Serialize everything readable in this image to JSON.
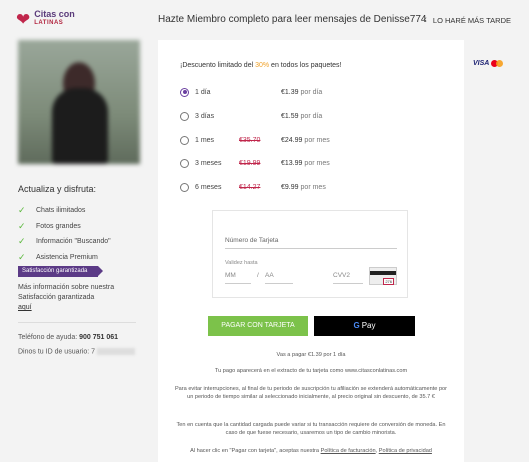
{
  "brand": {
    "line1": "Citas con",
    "line2": "LATINAS",
    "heart_icon": "heart-icon",
    "accent": "#c0264b"
  },
  "header": {
    "title": "Hazte Miembro completo para leer mensajes de Denisse774",
    "later_label": "LO HARÉ MÁS TARDE"
  },
  "sidebar": {
    "title": "Actualiza y disfruta:",
    "features": [
      "Chats ilimitados",
      "Fotos grandes",
      "Información \"Buscando\"",
      "Asistencia Premium"
    ],
    "badge": "Satisfacción garantizada",
    "more_info_text": "Más información sobre nuestra Satisfacción garantizada",
    "more_info_link": "aquí",
    "phone_label": "Teléfono de ayuda:",
    "phone_number": "900 751 061",
    "user_id_label": "Dinos tu ID de usuario:",
    "user_id_value": "7"
  },
  "offer": {
    "prefix": "¡Descuento limitado del ",
    "pct": "30%",
    "suffix": " en todos los paquetes!"
  },
  "plans": [
    {
      "name": "1 día",
      "old": "",
      "price": "€1.39",
      "per": "por día",
      "selected": true
    },
    {
      "name": "3 días",
      "old": "",
      "price": "€1.59",
      "per": "por día",
      "selected": false
    },
    {
      "name": "1 mes",
      "old": "€35.70",
      "price": "€24.99",
      "per": "por mes",
      "selected": false
    },
    {
      "name": "3 meses",
      "old": "€19.99",
      "price": "€13.99",
      "per": "por mes",
      "selected": false
    },
    {
      "name": "6 meses",
      "old": "€14.27",
      "price": "€9.99",
      "per": "por mes",
      "selected": false
    }
  ],
  "card_form": {
    "number_placeholder": "Número de Tarjeta",
    "valid_label": "Validez hasta",
    "mm_placeholder": "MM",
    "aa_placeholder": "AA",
    "cvv_placeholder": "CVV2",
    "cvv_hint": "276"
  },
  "buttons": {
    "pay_card": "PAGAR CON TARJETA",
    "gpay_g": "G",
    "gpay_text": "Pay"
  },
  "notes": {
    "will_pay": "Vas a pagar €1.39 por 1 día",
    "statement": "Tu pago aparecerá en el extracto de tu tarjeta como www.citasconlatinas.com",
    "renewal": "Para evitar interrupciones, al final de tu periodo de suscripción tu afiliación se extenderá automáticamente por un periodo de tiempo similar al seleccionado inicialmente, al precio original sin descuento, de 35.7 €",
    "currency": "Ten en cuenta que la cantidad cargada puede variar si tu transacción requiere de conversión de moneda. En caso de que fuese necesario, usaremos un tipo de cambio minorista.",
    "terms_prefix": "Al hacer clic en \"Pagar con tarjeta\", aceptas nuestra ",
    "terms_link1": "Política de facturación",
    "terms_mid": ", ",
    "terms_link2": "Política de privacidad"
  },
  "payment_logos": {
    "visa": "VISA",
    "mc_icon": "mastercard-icon"
  }
}
